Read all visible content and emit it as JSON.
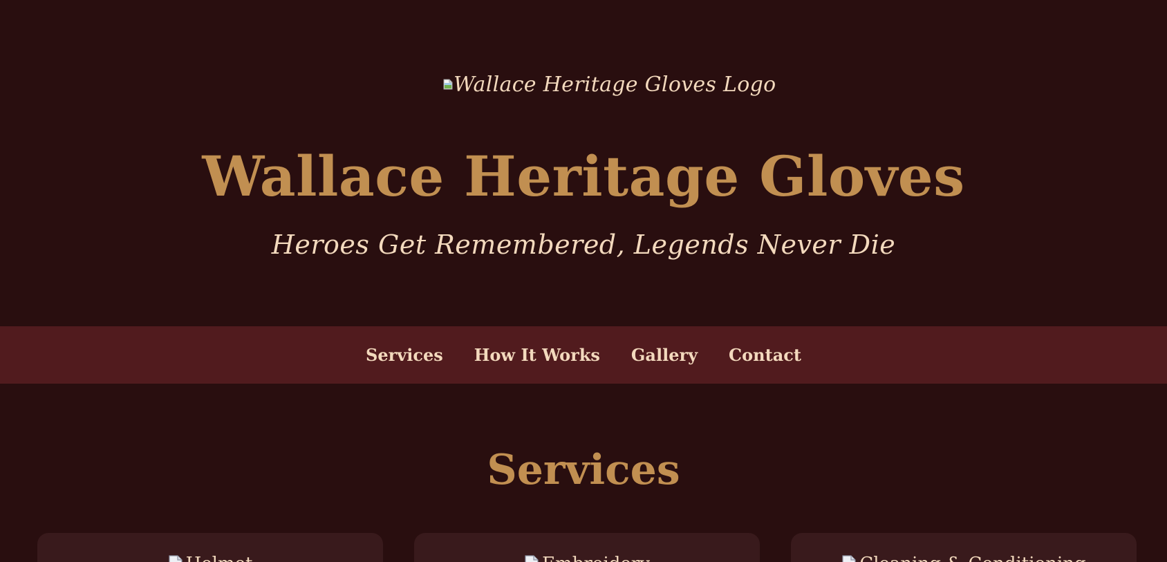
{
  "header": {
    "logo_alt": "Wallace Heritage Gloves Logo",
    "title": "Wallace Heritage Gloves",
    "tagline": "Heroes Get Remembered, Legends Never Die"
  },
  "nav": {
    "items": [
      {
        "label": "Services"
      },
      {
        "label": "How It Works"
      },
      {
        "label": "Gallery"
      },
      {
        "label": "Contact"
      }
    ]
  },
  "services": {
    "title": "Services",
    "cards": [
      {
        "image_alt": "Helmet",
        "icon": "broken-image-icon"
      },
      {
        "image_alt": "Embroidery",
        "icon": "broken-image-icon"
      },
      {
        "image_alt": "Cleaning & Conditioning",
        "icon": "broken-image-icon"
      }
    ]
  },
  "colors": {
    "background": "#290e0f",
    "nav_background": "#511b1e",
    "card_background": "#391a1c",
    "gold": "#c18f51",
    "cream": "#f3d9bd"
  }
}
